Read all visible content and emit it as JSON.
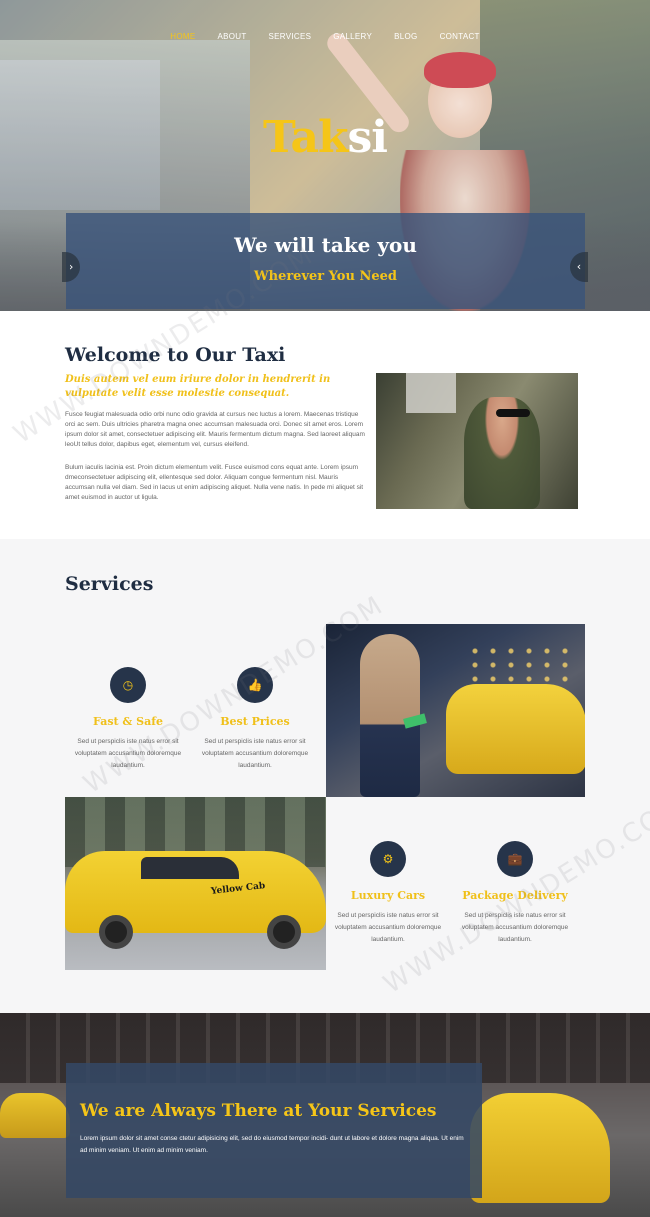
{
  "nav": {
    "items": [
      "HOME",
      "ABOUT",
      "SERVICES",
      "GALLERY",
      "BLOG",
      "CONTACT"
    ]
  },
  "hero": {
    "logo_part1": "Tak",
    "logo_part2": "si",
    "banner_title": "We will take you",
    "banner_subtitle": "Wherever You Need",
    "prev_arrow": "‹",
    "next_arrow": "‹"
  },
  "welcome": {
    "title": "Welcome to Our Taxi",
    "lead": "Duis autem vel eum iriure dolor in hendrerit in vulputate velit esse molestie consequat.",
    "p1": "Fusce feugiat malesuada odio orbi nunc odio gravida at cursus nec luctus a lorem. Maecenas tristique orci ac sem. Duis ultricies pharetra magna onec accumsan malesuada orci. Donec sit amet eros. Lorem ipsum dolor sit amet, consectetuer adipiscing elit. Mauris fermentum dictum magna. Sed laoreet aliquam leoUt tellus dolor, dapibus eget, elementum vel, cursus eleifend.",
    "p2": "Bulum iaculis lacinia est. Proin dictum elementum velit. Fusce euismod cons equat ante. Lorem ipsum dmeconsectetuer adipiscing elit, ellentesque sed dolor. Aliquam congue fermentum nisl. Mauris accumsan nulla vel diam. Sed in lacus ut enim adipiscing aliquet. Nulla vene natis. In pede mi aliquet sit amet euismod in auctor ut ligula."
  },
  "services": {
    "title": "Services",
    "items": [
      {
        "icon": "clock-icon",
        "glyph": "◷",
        "name": "Fast & Safe",
        "text": "Sed ut perspiclis iste natus error sit voluptatem accusantium doloremque laudantium."
      },
      {
        "icon": "thumbs-up-icon",
        "glyph": "👍",
        "name": "Best Prices",
        "text": "Sed ut perspiclis iste natus error sit voluptatem accusantium doloremque laudantium."
      },
      {
        "icon": "gear-icon",
        "glyph": "⚙",
        "name": "Luxury Cars",
        "text": "Sed ut perspiclis iste natus error sit voluptatem accusantium doloremque laudantium."
      },
      {
        "icon": "briefcase-icon",
        "glyph": "💼",
        "name": "Package Delivery",
        "text": "Sed ut perspiclis iste natus error sit voluptatem accusantium doloremque laudantium."
      }
    ],
    "cab_text": "Yellow Cab"
  },
  "bottom": {
    "title": "We are Always There at Your Services",
    "text": "Lorem ipsum dolor sit amet conse ctetur adipisicing elit, sed do eiusmod tempor incidi- dunt ut labore et dolore magna aliqua. Ut enim ad minim veniam. Ut enim ad minim veniam."
  },
  "watermark": "WWW.DOWNDEMO.COM",
  "colors": {
    "accent_yellow": "#f5c518",
    "navy": "#1f2d42",
    "banner_blue": "#3a547a"
  }
}
